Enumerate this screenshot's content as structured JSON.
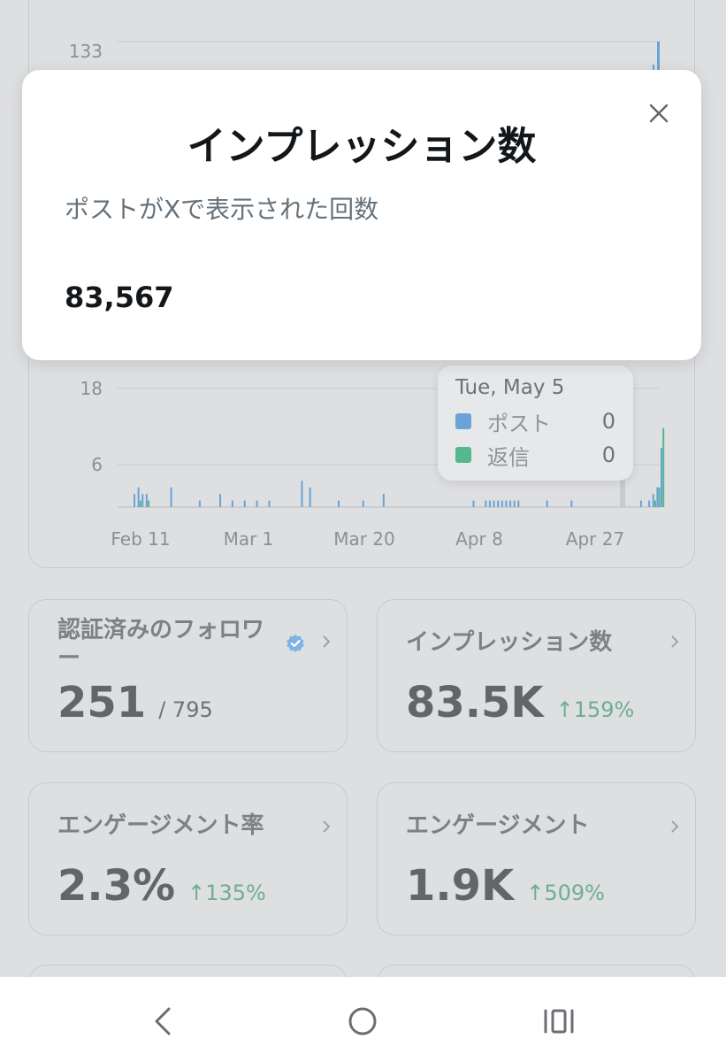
{
  "chart": {
    "y_ticks_upper": [
      "133"
    ],
    "y_ticks_lower": [
      "18",
      "6"
    ],
    "x_ticks": [
      "Feb 11",
      "Mar 1",
      "Mar 20",
      "Apr 8",
      "Apr 27"
    ],
    "tooltip": {
      "date": "Tue, May 5",
      "items": [
        {
          "label": "ポスト",
          "value": "0",
          "color": "#6aa3d8"
        },
        {
          "label": "返信",
          "value": "0",
          "color": "#55b78d"
        }
      ]
    }
  },
  "chart_data": {
    "type": "bar",
    "title": "",
    "xlabel": "",
    "ylabel": "",
    "ylim": [
      0,
      22
    ],
    "series": [
      {
        "name": "ポスト",
        "color": "#6aa3d8",
        "values": [
          2,
          3,
          2,
          2,
          0,
          0,
          0,
          0,
          0,
          3,
          0,
          0,
          0,
          0,
          0,
          0,
          1,
          0,
          0,
          0,
          0,
          2,
          0,
          0,
          1,
          0,
          0,
          1,
          0,
          0,
          1,
          0,
          0,
          1,
          0,
          0,
          0,
          0,
          0,
          0,
          0,
          4,
          0,
          3,
          0,
          0,
          0,
          0,
          0,
          0,
          1,
          0,
          0,
          0,
          0,
          0,
          1,
          0,
          0,
          0,
          0,
          2,
          0,
          0,
          0,
          0,
          0,
          0,
          0,
          0,
          0,
          0,
          0,
          0,
          0,
          0,
          0,
          0,
          0,
          0,
          0,
          0,
          0,
          1,
          0,
          0,
          1,
          1,
          1,
          1,
          1,
          1,
          1,
          1,
          1,
          0,
          0,
          0,
          0,
          0,
          0,
          1,
          0,
          0,
          0,
          0,
          0,
          1,
          0,
          0,
          0,
          0,
          0,
          0,
          0,
          0,
          0,
          0,
          0,
          0,
          0,
          0,
          0,
          0,
          1,
          0,
          1,
          2,
          3,
          9
        ]
      },
      {
        "name": "返信",
        "color": "#55b78d",
        "values": [
          0,
          1,
          0,
          1,
          0,
          0,
          0,
          0,
          0,
          0,
          0,
          0,
          0,
          0,
          0,
          0,
          0,
          0,
          0,
          0,
          0,
          0,
          0,
          0,
          0,
          0,
          0,
          0,
          0,
          0,
          0,
          0,
          0,
          0,
          0,
          0,
          0,
          0,
          0,
          0,
          0,
          0,
          0,
          0,
          0,
          0,
          0,
          0,
          0,
          0,
          0,
          0,
          0,
          0,
          0,
          0,
          0,
          0,
          0,
          0,
          0,
          0,
          0,
          0,
          0,
          0,
          0,
          0,
          0,
          0,
          0,
          0,
          0,
          0,
          0,
          0,
          0,
          0,
          0,
          0,
          0,
          0,
          0,
          0,
          0,
          0,
          0,
          0,
          0,
          0,
          0,
          0,
          0,
          0,
          0,
          0,
          0,
          0,
          0,
          0,
          0,
          0,
          0,
          0,
          0,
          0,
          0,
          0,
          0,
          0,
          0,
          0,
          0,
          0,
          0,
          0,
          0,
          0,
          0,
          0,
          0,
          0,
          0,
          0,
          0,
          0,
          0,
          1,
          3,
          12
        ]
      }
    ]
  },
  "metrics": [
    {
      "title": "認証済みのフォロワー",
      "value": "251",
      "sub": "/ 795",
      "delta": ""
    },
    {
      "title": "インプレッション数",
      "value": "83.5K",
      "sub": "",
      "delta": "↑159%"
    },
    {
      "title": "エンゲージメント率",
      "value": "2.3%",
      "sub": "",
      "delta": "↑135%"
    },
    {
      "title": "エンゲージメント",
      "value": "1.9K",
      "sub": "",
      "delta": "↑509%"
    }
  ],
  "modal": {
    "title": "インプレッション数",
    "description": "ポストがXで表示された回数",
    "value": "83,567"
  },
  "colors": {
    "accent_blue": "#6aa3d8",
    "accent_green": "#55b78d",
    "delta_green": "#6fae8e",
    "verified_blue": "#7fb2e5"
  }
}
